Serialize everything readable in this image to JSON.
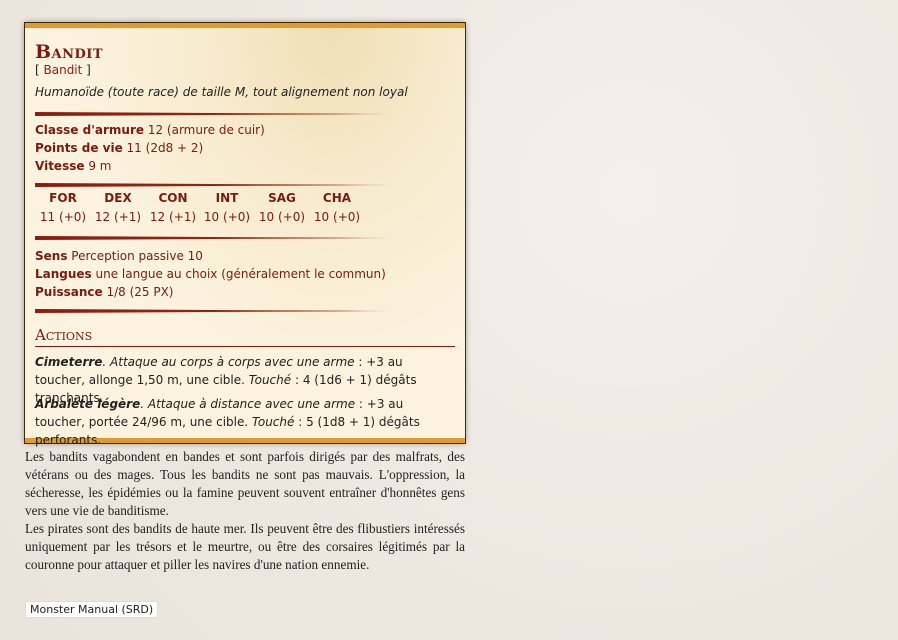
{
  "monster": {
    "name": "Bandit",
    "tag_open": "[ ",
    "tag_link": "Bandit",
    "tag_close": " ]",
    "meta": "Humanoïde (toute race) de taille M, tout alignement non loyal"
  },
  "stats": {
    "ac_label": "Classe d'armure",
    "ac_value": " 12 (armure de cuir)",
    "hp_label": "Points de vie",
    "hp_value": " 11 (2d8 + 2)",
    "speed_label": "Vitesse",
    "speed_value": " 9 m"
  },
  "abilities": [
    {
      "name": "FOR",
      "value": "11 (+0)"
    },
    {
      "name": "DEX",
      "value": "12 (+1)"
    },
    {
      "name": "CON",
      "value": "12 (+1)"
    },
    {
      "name": "INT",
      "value": "10 (+0)"
    },
    {
      "name": "SAG",
      "value": "10 (+0)"
    },
    {
      "name": "CHA",
      "value": "10 (+0)"
    }
  ],
  "details": {
    "senses_label": "Sens",
    "senses_value": " Perception passive 10",
    "languages_label": "Langues",
    "languages_value": " une langue au choix (généralement le commun)",
    "power_label": "Puissance",
    "power_value": " 1/8 (25 PX)"
  },
  "actions": {
    "title": "Actions",
    "items": [
      {
        "name": "Cimeterre",
        "type": ". Attaque au corps à corps avec une arme",
        "text1": " : +3 au toucher, allonge 1,50 m, une cible. ",
        "hit": "Touché",
        "text2": " : 4 (1d6 + 1) dégâts tranchants."
      },
      {
        "name": "Arbalète légère",
        "type": ". Attaque à distance avec une arme",
        "text1": " : +3 au toucher, portée 24/96 m, une cible. ",
        "hit": "Touché",
        "text2": " : 5 (1d8 + 1) dégâts perforants."
      }
    ]
  },
  "description": [
    "Les bandits vagabondent en bandes et sont parfois dirigés par des malfrats, des vétérans ou des mages. Tous les bandits ne sont pas mauvais. L'oppression, la sécheresse, les épidémies ou la famine peuvent souvent entraîner d'honnêtes gens vers une vie de banditisme.",
    "Les pirates sont des bandits de haute mer. Ils peuvent être des flibustiers intéressés uniquement par les trésors et le meurtre, ou être des corsaires légitimés par la couronne pour attaquer et piller les navires d'une nation ennemie."
  ],
  "source": "Monster Manual (SRD)",
  "colors": {
    "accent": "#7a1b0f",
    "border": "#e09b2b",
    "parchment": "#fbf3df"
  }
}
